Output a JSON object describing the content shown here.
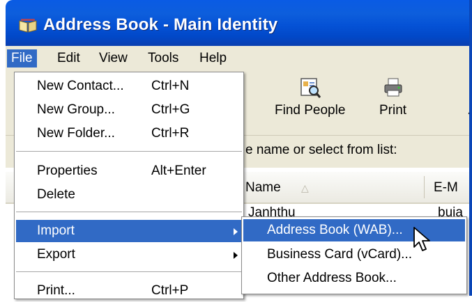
{
  "window": {
    "title": "Address Book - Main Identity"
  },
  "menubar": [
    "File",
    "Edit",
    "View",
    "Tools",
    "Help"
  ],
  "toolbar": [
    {
      "label": "Find People",
      "icon": "find-people-icon"
    },
    {
      "label": "Print",
      "icon": "printer-icon"
    },
    {
      "label": "A",
      "icon": "action-icon"
    }
  ],
  "search": {
    "label": "e name or select from list:"
  },
  "list": {
    "columns": [
      {
        "label": "Name"
      },
      {
        "label": "E-M"
      }
    ],
    "rows": [
      {
        "name": "Janhthu",
        "email": "buia"
      }
    ]
  },
  "file_menu": {
    "items": [
      {
        "label": "New Contact...",
        "shortcut": "Ctrl+N"
      },
      {
        "label": "New Group...",
        "shortcut": "Ctrl+G"
      },
      {
        "label": "New Folder...",
        "shortcut": "Ctrl+R"
      },
      {
        "label": "Properties",
        "shortcut": "Alt+Enter"
      },
      {
        "label": "Delete",
        "shortcut": ""
      },
      {
        "label": "Import",
        "shortcut": "",
        "submenu": true,
        "highlighted": true
      },
      {
        "label": "Export",
        "shortcut": "",
        "submenu": true
      },
      {
        "label": "Print...",
        "shortcut": "Ctrl+P"
      }
    ]
  },
  "import_submenu": {
    "items": [
      {
        "label": "Address Book (WAB)...",
        "highlighted": true
      },
      {
        "label": "Business Card (vCard)..."
      },
      {
        "label": "Other Address Book..."
      }
    ]
  },
  "colors": {
    "titlebar": "#0552d6",
    "menu_highlight": "#316ac5",
    "chrome": "#ece9d8"
  }
}
